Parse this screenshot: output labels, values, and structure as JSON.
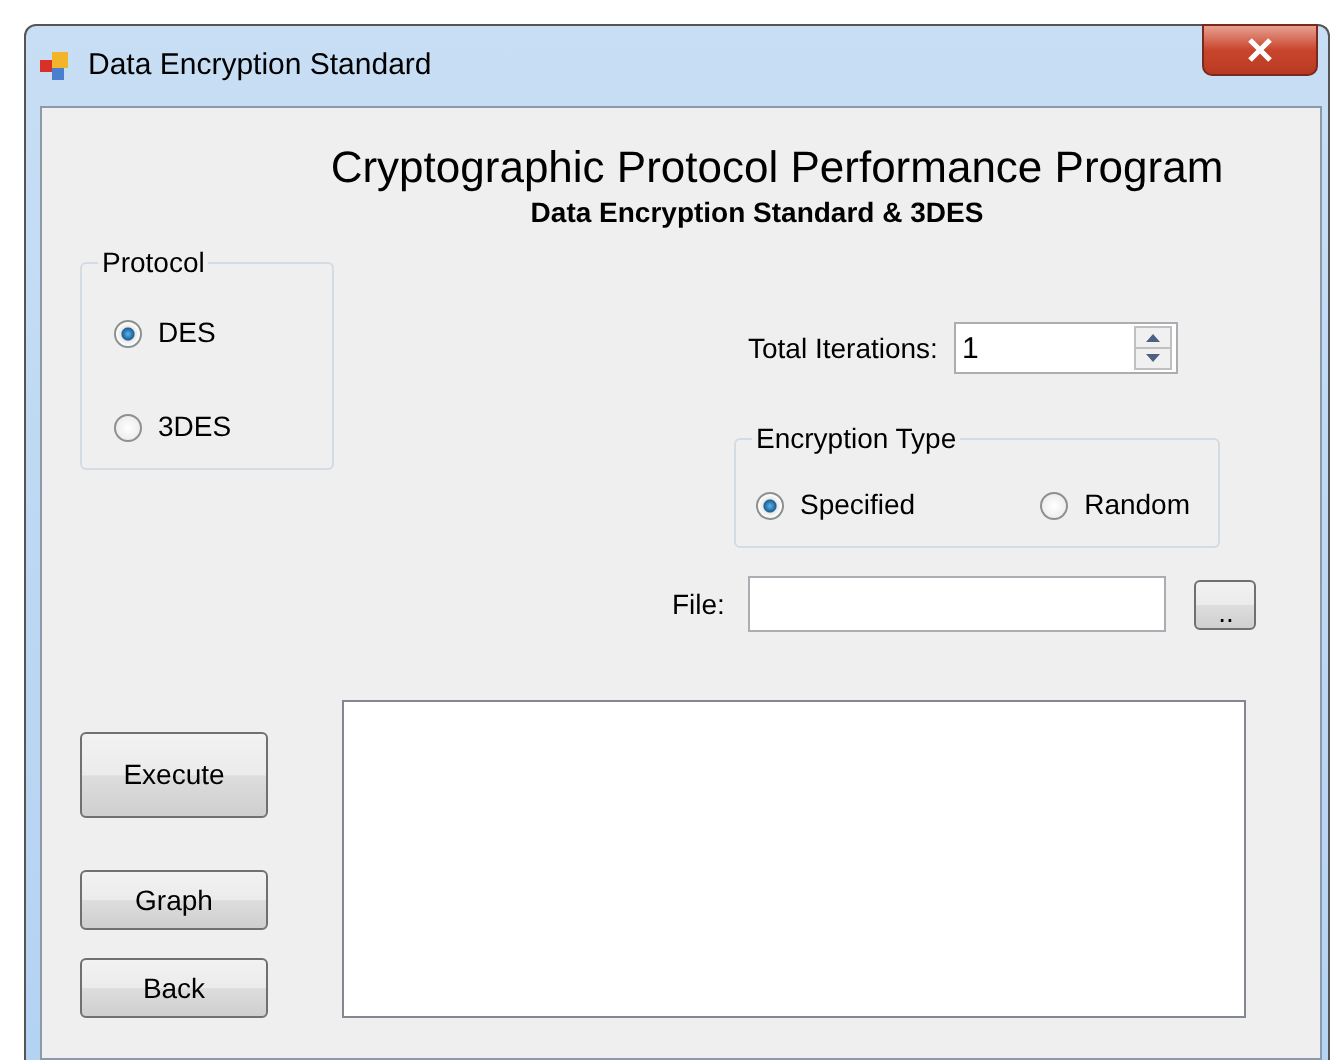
{
  "window": {
    "title": "Data Encryption Standard"
  },
  "heading": "Cryptographic Protocol Performance Program",
  "subheading": "Data Encryption Standard & 3DES",
  "protocol": {
    "label": "Protocol",
    "options": [
      {
        "label": "DES",
        "selected": true
      },
      {
        "label": "3DES",
        "selected": false
      }
    ]
  },
  "total_iterations": {
    "label": "Total Iterations:",
    "value": "1"
  },
  "encryption_type": {
    "label": "Encryption Type",
    "options": [
      {
        "label": "Specified",
        "selected": true
      },
      {
        "label": "Random",
        "selected": false
      }
    ]
  },
  "file": {
    "label": "File:",
    "browse_button": ".."
  },
  "buttons": [
    "Execute",
    "Graph",
    "Back"
  ]
}
